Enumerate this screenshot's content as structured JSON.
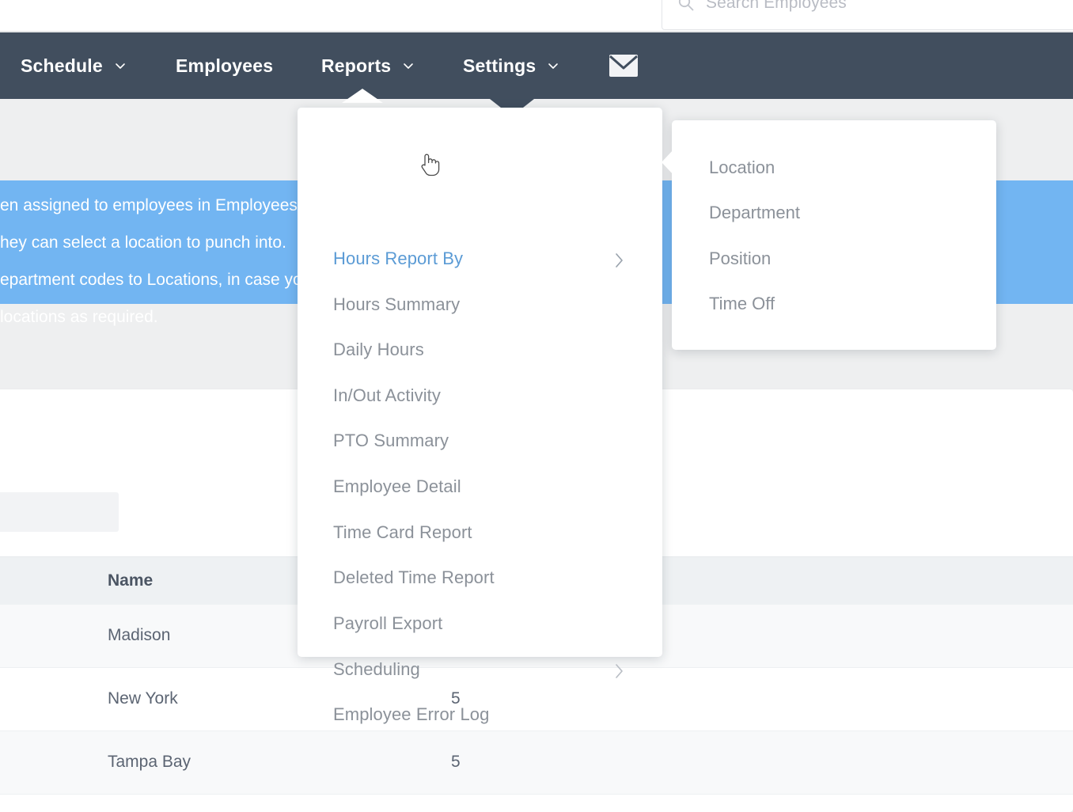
{
  "search": {
    "placeholder": "Search Employees",
    "icon": "search-icon"
  },
  "navbar": {
    "background": "#414e5e",
    "items": [
      {
        "label": "Schedule",
        "caret": true,
        "name": "schedule"
      },
      {
        "label": "Employees",
        "caret": false,
        "name": "employees"
      },
      {
        "label": "Reports",
        "caret": true,
        "name": "reports"
      },
      {
        "label": "Settings",
        "caret": true,
        "name": "settings"
      }
    ],
    "mail_icon": "envelope-icon"
  },
  "info_banner": {
    "background": "#72b5f2",
    "lines": [
      "en assigned to employees in Employees",
      "hey can select a location to punch into.",
      "epartment codes to Locations, in case yo",
      "locations as required."
    ]
  },
  "reports_menu": {
    "items": [
      {
        "label": "Hours Report By",
        "submenu": true,
        "active": true
      },
      {
        "label": "Hours Summary",
        "submenu": false,
        "active": false
      },
      {
        "label": "Daily Hours",
        "submenu": false,
        "active": false
      },
      {
        "label": "In/Out Activity",
        "submenu": false,
        "active": false
      },
      {
        "label": "PTO Summary",
        "submenu": false,
        "active": false
      },
      {
        "label": "Employee Detail",
        "submenu": false,
        "active": false
      },
      {
        "label": "Time Card Report",
        "submenu": false,
        "active": false
      },
      {
        "label": "Deleted Time Report",
        "submenu": false,
        "active": false
      },
      {
        "label": "Payroll Export",
        "submenu": false,
        "active": false
      },
      {
        "label": "Scheduling",
        "submenu": true,
        "active": false
      },
      {
        "label": "Employee Error Log",
        "submenu": false,
        "active": false
      }
    ],
    "active_color": "#5b9bd5",
    "text_color": "#8b9199"
  },
  "sub_menu": {
    "items": [
      {
        "label": "Location"
      },
      {
        "label": "Department"
      },
      {
        "label": "Position"
      },
      {
        "label": "Time Off"
      }
    ]
  },
  "table": {
    "columns": [
      "Name"
    ],
    "rows": [
      {
        "name": "Madison",
        "count": ""
      },
      {
        "name": "New York",
        "count": "5"
      },
      {
        "name": "Tampa Bay",
        "count": "5"
      }
    ]
  }
}
